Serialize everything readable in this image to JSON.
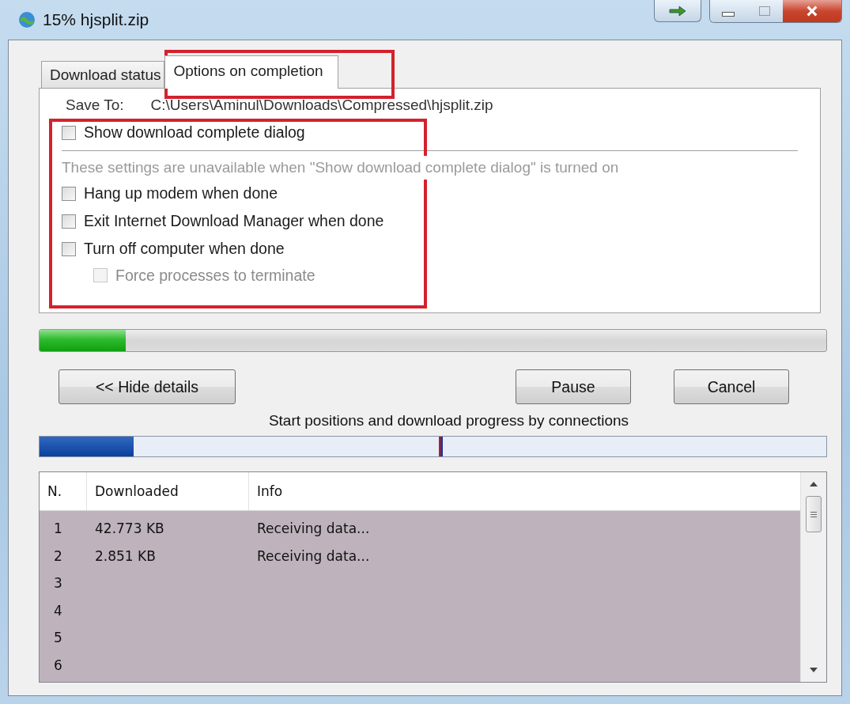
{
  "window": {
    "title": "15% hjsplit.zip"
  },
  "tabs": [
    {
      "label": "Download status",
      "selected": false
    },
    {
      "label": "Options on completion",
      "selected": true
    }
  ],
  "save_to": {
    "label": "Save To:",
    "value": "C:\\Users\\Aminul\\Downloads\\Compressed\\hjsplit.zip"
  },
  "show_dialog": {
    "label": "Show download complete dialog",
    "checked": false,
    "disabled": false
  },
  "note": "These settings are unavailable when \"Show download complete dialog\" is turned on",
  "options": [
    {
      "label": "Hang up modem when done",
      "checked": false,
      "disabled": false
    },
    {
      "label": "Exit Internet Download Manager when done",
      "checked": false,
      "disabled": false
    },
    {
      "label": "Turn off computer when done",
      "checked": false,
      "disabled": false,
      "children": [
        {
          "label": "Force processes to terminate",
          "checked": false,
          "disabled": true
        }
      ]
    }
  ],
  "progress": {
    "level": 0.11
  },
  "buttons": {
    "details": "<< Hide details",
    "pause": "Pause",
    "cancel": "Cancel"
  },
  "connections_caption": "Start positions and download progress by connections",
  "table": {
    "columns": [
      "N.",
      "Downloaded",
      "Info"
    ],
    "rows": [
      {
        "n": "1",
        "downloaded": "42.773 KB",
        "info": "Receiving data..."
      },
      {
        "n": "2",
        "downloaded": "2.851 KB",
        "info": "Receiving data..."
      },
      {
        "n": "3"
      },
      {
        "n": "4"
      },
      {
        "n": "5"
      },
      {
        "n": "6"
      }
    ]
  }
}
